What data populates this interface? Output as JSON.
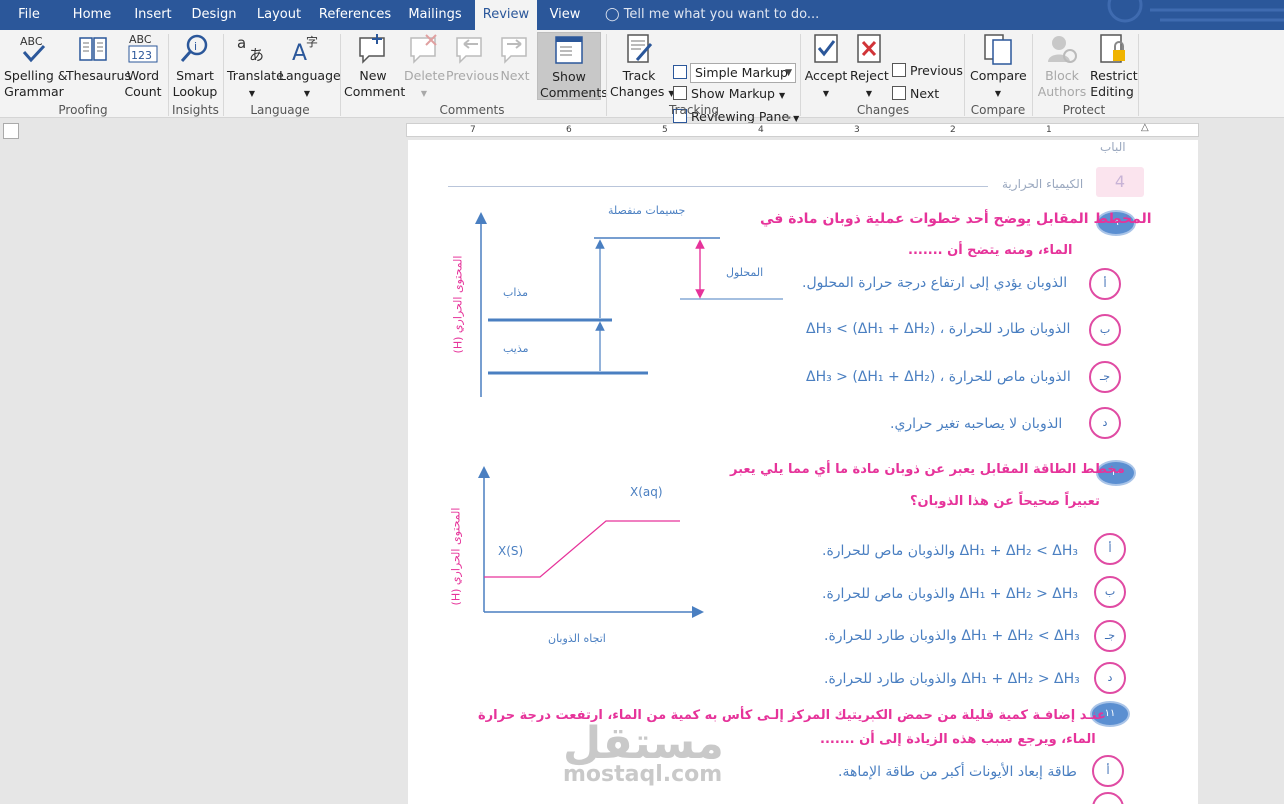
{
  "tabs": [
    "File",
    "Home",
    "Insert",
    "Design",
    "Layout",
    "References",
    "Mailings",
    "Review",
    "View"
  ],
  "tell_me": "Tell me what you want to do...",
  "ribbon": {
    "proofing": {
      "spelling": "Spelling &",
      "spelling2": "Grammar",
      "thesaurus": "Thesaurus",
      "wordcount": "Word",
      "wordcount2": "Count",
      "group": "Proofing",
      "abc": "ABC",
      "n123": "123"
    },
    "insights": {
      "smartlookup": "Smart",
      "smartlookup2": "Lookup",
      "group": "Insights"
    },
    "language": {
      "translate": "Translate",
      "language": "Language",
      "group": "Language"
    },
    "comments": {
      "new": "New",
      "new2": "Comment",
      "delete": "Delete",
      "previous": "Previous",
      "next": "Next",
      "show": "Show",
      "show2": "Comments",
      "group": "Comments"
    },
    "tracking": {
      "track": "Track",
      "track2": "Changes",
      "markup_value": "Simple Markup",
      "show_markup": "Show Markup",
      "reviewing_pane": "Reviewing Pane",
      "group": "Tracking"
    },
    "changes": {
      "accept": "Accept",
      "reject": "Reject",
      "previous": "Previous",
      "next": "Next",
      "group": "Changes"
    },
    "compare": {
      "compare": "Compare",
      "group": "Compare"
    },
    "protect": {
      "block": "Block",
      "block2": "Authors",
      "restrict": "Restrict",
      "restrict2": "Editing",
      "group": "Protect"
    }
  },
  "ruler_ticks": [
    "7",
    "6",
    "5",
    "4",
    "3",
    "2",
    "1"
  ],
  "document": {
    "header_top": "الباب",
    "chapter_title": "الكيمياء الحرارية",
    "chapter_number": "4",
    "q9": {
      "num": "٩",
      "line1": "المخطط المقابل يوضح أحد خطوات عملية ذوبان مادة في",
      "line2": "الماء، ومنه يتضح أن .......",
      "options": [
        {
          "letter": "أ",
          "text": "الذوبان يؤدي إلى ارتفاع درجة حرارة المحلول."
        },
        {
          "letter": "ب",
          "text": "الذوبان طارد للحرارة ، ΔH₃ < (ΔH₁ + ΔH₂)"
        },
        {
          "letter": "جـ",
          "text": "الذوبان ماص للحرارة ، ΔH₃ > (ΔH₁ + ΔH₂)"
        },
        {
          "letter": "د",
          "text": "الذوبان لا يصاحبه تغير حراري."
        }
      ],
      "diagram": {
        "separated": "جسيمات منفصلة",
        "solution": "المحلول",
        "solute": "مذاب",
        "solvent": "مذيب",
        "axis": "المحتوى الحراري (H)"
      }
    },
    "q10": {
      "num": "١٠",
      "line1": "مخطط الطاقة المقابل يعبر عن ذوبان مادة ما أي مما يلي يعبر",
      "line2": "تعبيراً صحيحاً عن هذا الذوبان؟",
      "options": [
        {
          "letter": "أ",
          "text": "ΔH₁ + ΔH₂ < ΔH₃ والذوبان ماص للحرارة."
        },
        {
          "letter": "ب",
          "text": "ΔH₁ + ΔH₂ > ΔH₃ والذوبان ماص للحرارة."
        },
        {
          "letter": "جـ",
          "text": "ΔH₁ + ΔH₂ < ΔH₃ والذوبان طارد للحرارة."
        },
        {
          "letter": "د",
          "text": "ΔH₁ + ΔH₂ > ΔH₃ والذوبان طارد للحرارة."
        }
      ],
      "diagram": {
        "xs": "X(S)",
        "xaq": "X(aq)",
        "axis": "المحتوى الحراري (H)",
        "direction": "اتجاه الذوبان"
      }
    },
    "q11": {
      "num": "١١",
      "line1": "عنـد إضافـة كمية قليلة من حمض الكبريتيك المركز إلـى كأس به كمية من الماء، ارتفعت درجة حرارة",
      "line2": "الماء، ويرجع سبب هذه الزيادة إلى أن .......",
      "options": [
        {
          "letter": "أ",
          "text": "طاقة إبعاد الأيونات أكبر من طاقة الإماهة."
        }
      ]
    },
    "watermark": "مستقل",
    "watermark_url": "mostaql.com"
  },
  "colors": {
    "ribbon_blue": "#2b579a",
    "pink": "#e6339a",
    "blue": "#4a7fc1"
  }
}
